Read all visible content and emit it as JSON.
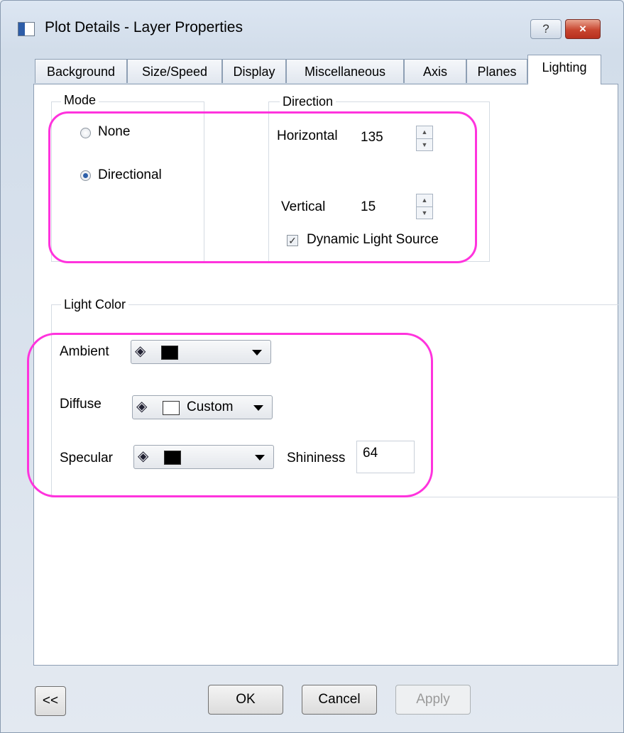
{
  "window": {
    "title": "Plot Details - Layer Properties",
    "help_label": "?",
    "close_label": "×"
  },
  "tabs": [
    {
      "label": "Background"
    },
    {
      "label": "Size/Speed"
    },
    {
      "label": "Display"
    },
    {
      "label": "Miscellaneous"
    },
    {
      "label": "Axis"
    },
    {
      "label": "Planes"
    },
    {
      "label": "Lighting",
      "active": true
    }
  ],
  "mode": {
    "label": "Mode",
    "options": [
      {
        "label": "None",
        "selected": false
      },
      {
        "label": "Directional",
        "selected": true
      }
    ]
  },
  "direction": {
    "label": "Direction",
    "horizontal_label": "Horizontal",
    "horizontal_value": "135",
    "vertical_label": "Vertical",
    "vertical_value": "15",
    "dynamic_label": "Dynamic Light Source",
    "dynamic_checked": true
  },
  "light_color": {
    "label": "Light Color",
    "ambient_label": "Ambient",
    "ambient_color": "#000000",
    "diffuse_label": "Diffuse",
    "diffuse_color": "#ffffff",
    "diffuse_text": "Custom",
    "specular_label": "Specular",
    "specular_color": "#000000",
    "shininess_label": "Shininess",
    "shininess_value": "64"
  },
  "buttons": {
    "back": "<<",
    "ok": "OK",
    "cancel": "Cancel",
    "apply": "Apply"
  },
  "colors": {
    "highlight": "#ff33dd",
    "accent": "#2c5ea8"
  }
}
